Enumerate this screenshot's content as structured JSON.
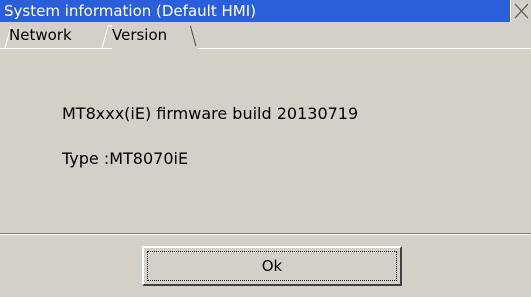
{
  "window": {
    "title": "System information (Default HMI)",
    "title_color": "#2b5fd9",
    "close_icon": "close-icon"
  },
  "tabs": [
    {
      "label": "Network",
      "active": false
    },
    {
      "label": "Version",
      "active": true
    }
  ],
  "version": {
    "firmware": "MT8xxx(iE) firmware build 20130719",
    "type": "Type :MT8070iE"
  },
  "footer": {
    "ok_label": "Ok"
  }
}
